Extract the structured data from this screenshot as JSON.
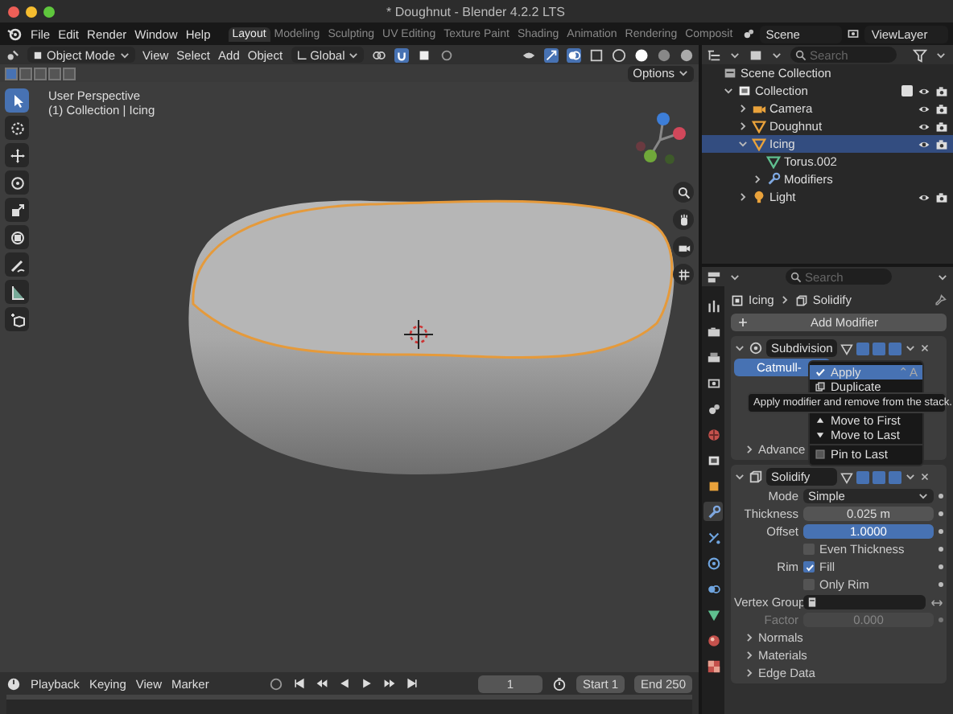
{
  "window": {
    "title": "* Doughnut - Blender 4.2.2 LTS"
  },
  "menu": [
    "File",
    "Edit",
    "Render",
    "Window",
    "Help"
  ],
  "workspaces": [
    {
      "label": "Layout",
      "selected": true
    },
    {
      "label": "Modeling",
      "selected": false
    },
    {
      "label": "Sculpting",
      "selected": false
    },
    {
      "label": "UV Editing",
      "selected": false
    },
    {
      "label": "Texture Paint",
      "selected": false
    },
    {
      "label": "Shading",
      "selected": false
    },
    {
      "label": "Animation",
      "selected": false
    },
    {
      "label": "Rendering",
      "selected": false
    },
    {
      "label": "Composit",
      "selected": false
    }
  ],
  "scene": {
    "name": "Scene"
  },
  "view_layer": {
    "name": "ViewLayer"
  },
  "viewport": {
    "mode": "Object Mode",
    "menus": [
      "View",
      "Select",
      "Add",
      "Object"
    ],
    "orientation": "Global",
    "options": "Options",
    "overlay_text": [
      "User Perspective",
      "(1) Collection | Icing"
    ],
    "tools": [
      {
        "kind": "select",
        "selected": true
      },
      {
        "kind": "cursor",
        "selected": false
      },
      {
        "kind": "move",
        "selected": false
      },
      {
        "kind": "rotate",
        "selected": false
      },
      {
        "kind": "scale",
        "selected": false
      },
      {
        "kind": "transform",
        "selected": false
      },
      {
        "kind": "annotate",
        "selected": false
      },
      {
        "kind": "measure",
        "selected": false
      },
      {
        "kind": "add_cube",
        "selected": false
      }
    ]
  },
  "outliner": {
    "search": {
      "placeholder": "Search"
    },
    "tree": [
      {
        "name": "Scene Collection",
        "kind": "scene",
        "selected": false,
        "children": [
          {
            "name": "Collection",
            "kind": "collection",
            "expanded": true,
            "selected": false,
            "children": [
              {
                "name": "Camera",
                "kind": "camera",
                "expanded": false,
                "selected": false
              },
              {
                "name": "Doughnut",
                "kind": "mesh",
                "expanded": false,
                "selected": false
              },
              {
                "name": "Icing",
                "kind": "mesh",
                "expanded": true,
                "selected": true,
                "children": [
                  {
                    "name": "Torus.002",
                    "kind": "mesh_data",
                    "selected": false
                  },
                  {
                    "name": "Modifiers",
                    "kind": "modifiers",
                    "expanded": false,
                    "selected": false
                  }
                ]
              },
              {
                "name": "Light",
                "kind": "light",
                "expanded": false,
                "selected": false
              }
            ]
          }
        ]
      }
    ]
  },
  "properties": {
    "search": {
      "placeholder": "Search"
    },
    "tabs": [
      {
        "kind": "tool",
        "selected": false
      },
      {
        "kind": "render",
        "selected": false
      },
      {
        "kind": "output",
        "selected": false
      },
      {
        "kind": "view_layer",
        "selected": false
      },
      {
        "kind": "scene",
        "selected": false
      },
      {
        "kind": "world",
        "selected": false
      },
      {
        "kind": "collection",
        "selected": false
      },
      {
        "kind": "object",
        "selected": false
      },
      {
        "kind": "modifier",
        "selected": true
      },
      {
        "kind": "particles",
        "selected": false
      },
      {
        "kind": "physics",
        "selected": false
      },
      {
        "kind": "constraints",
        "selected": false
      },
      {
        "kind": "data",
        "selected": false
      },
      {
        "kind": "material",
        "selected": false
      },
      {
        "kind": "texture",
        "selected": false
      }
    ],
    "breadcrumb": [
      "Icing",
      "Solidify"
    ],
    "add_modifier": "Add Modifier",
    "modifiers": [
      {
        "kind": "subdivision",
        "name": "Subdivision",
        "expanded": true,
        "segment": "Catmull-",
        "subpanels": [
          {
            "label": "Advance",
            "expanded": false
          }
        ]
      },
      {
        "kind": "solidify",
        "name": "Solidify",
        "expanded": true,
        "fields": [
          {
            "kind": "dropdown",
            "label": "Mode",
            "value": "Simple",
            "disabled": false
          },
          {
            "kind": "number",
            "label": "Thickness",
            "value": "0.025 m",
            "disabled": false
          },
          {
            "kind": "slider",
            "label": "Offset",
            "value": "1.0000",
            "level": 1,
            "disabled": false
          },
          {
            "kind": "checkbox",
            "text": "Even Thickness",
            "checked": false,
            "disabled": false
          },
          {
            "kind": "checkbox",
            "label": "Rim",
            "text": "Fill",
            "checked": true,
            "disabled": false
          },
          {
            "kind": "checkbox",
            "text": "Only Rim",
            "checked": false,
            "disabled": false
          },
          {
            "kind": "vertex_group",
            "label": "Vertex Group",
            "disabled": false
          },
          {
            "kind": "number",
            "label": "Factor",
            "value": "0.000",
            "disabled": true
          }
        ],
        "subpanels": [
          {
            "label": "Normals",
            "expanded": false
          },
          {
            "label": "Materials",
            "expanded": false
          },
          {
            "label": "Edge Data",
            "expanded": false
          }
        ]
      }
    ],
    "context_menu": [
      {
        "kind": "apply",
        "label": "Apply",
        "shortcut": "⌃A",
        "selected": true
      },
      {
        "kind": "duplicate",
        "label": "Duplicate",
        "selected": false
      },
      {
        "kind": "move_up",
        "label": "Move to First",
        "selected": false
      },
      {
        "kind": "move_down",
        "label": "Move to Last",
        "selected": false
      },
      {
        "kind": "pin",
        "label": "Pin to Last",
        "selected": false,
        "checked": false
      }
    ],
    "tooltip": "Apply modifier and remove from the stack."
  },
  "timeline": {
    "menus": [
      "Playback",
      "Keying",
      "View",
      "Marker"
    ],
    "current_frame": "1",
    "start_label": "Start",
    "start": "1",
    "end_label": "End",
    "end": "250"
  }
}
